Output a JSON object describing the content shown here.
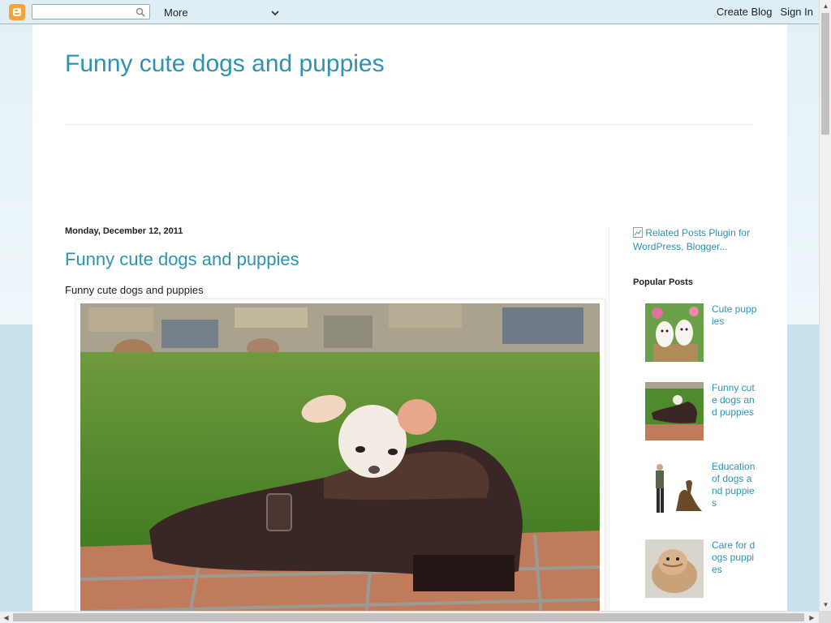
{
  "navbar": {
    "logo_icon": "blogger-logo-icon",
    "search": {
      "value": "",
      "placeholder": "",
      "icon": "search-icon"
    },
    "more_label": "More",
    "create_blog_label": "Create Blog",
    "sign_in_label": "Sign In"
  },
  "blog": {
    "title": "Funny cute dogs and puppies"
  },
  "post": {
    "date": "Monday, December 12, 2011",
    "title": "Funny cute dogs and puppies",
    "body_text": "Funny cute dogs and puppies",
    "image_alt": "Chihuahua puppy sitting in a leather shoe on grass"
  },
  "sidebar": {
    "related_link": "Related Posts Plugin for WordPress, Blogger...",
    "popular_heading": "Popular Posts",
    "popular_posts": [
      {
        "label": "Cute puppies"
      },
      {
        "label": "Funny cute dogs and puppies"
      },
      {
        "label": "Education of dogs and puppies"
      },
      {
        "label": "Care for dogs puppies"
      }
    ]
  },
  "colors": {
    "link": "#2d93b1",
    "accent_logo": "#f6a23c",
    "page_background": "#c8e3ee"
  }
}
